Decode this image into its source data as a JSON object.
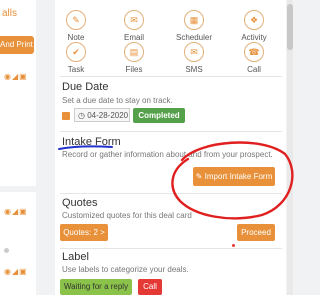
{
  "left": {
    "heading": "alls",
    "button": "And Print"
  },
  "activities": [
    {
      "label": "Note",
      "icon": "note-icon",
      "glyph": "✎"
    },
    {
      "label": "Email",
      "icon": "email-icon",
      "glyph": "✉"
    },
    {
      "label": "Scheduler",
      "icon": "scheduler-icon",
      "glyph": "▦"
    },
    {
      "label": "Activity",
      "icon": "activity-icon",
      "glyph": "❖"
    },
    {
      "label": "Task",
      "icon": "task-icon",
      "glyph": "✔"
    },
    {
      "label": "Files",
      "icon": "files-icon",
      "glyph": "▤"
    },
    {
      "label": "SMS",
      "icon": "sms-icon",
      "glyph": "✉"
    },
    {
      "label": "Call",
      "icon": "call-icon",
      "glyph": "☎"
    }
  ],
  "due_date": {
    "title": "Due Date",
    "description": "Set a due date to stay on track.",
    "date": "04-28-2020",
    "status": "Completed"
  },
  "intake_form": {
    "title": "Intake Form",
    "description": "Record or gather information about and from your prospect.",
    "button": "Import Intake Form"
  },
  "quotes": {
    "title": "Quotes",
    "description": "Customized quotes for this deal card",
    "button": "Quotes: 2 >",
    "proceed": "Proceed"
  },
  "label": {
    "title": "Label",
    "description": "Use labels to categorize your deals.",
    "tags": [
      "Waiting for a reply",
      "Call"
    ]
  },
  "colors": {
    "accent": "#e8913a",
    "completed": "#55a04a",
    "label_green": "#8bc34a",
    "label_red": "#e53935",
    "annotation_blue": "#2233cc",
    "annotation_red": "#e02020"
  }
}
